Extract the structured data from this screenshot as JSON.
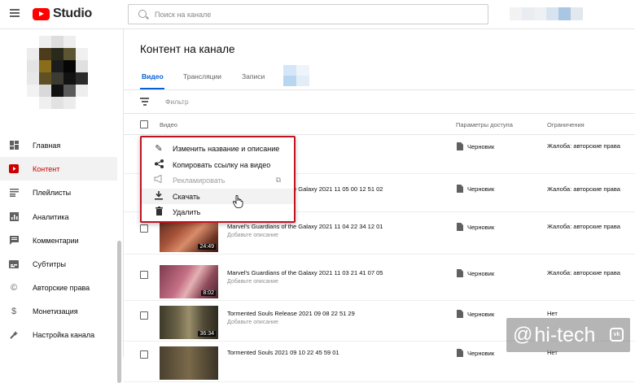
{
  "app": {
    "logo_text": "Studio",
    "brand_color": "#ff0000"
  },
  "search": {
    "placeholder": "Поиск на канале"
  },
  "sidebar": {
    "items": [
      {
        "label": "Главная",
        "icon": "dashboard-icon"
      },
      {
        "label": "Контент",
        "icon": "content-icon",
        "active": true
      },
      {
        "label": "Плейлисты",
        "icon": "playlist-icon"
      },
      {
        "label": "Аналитика",
        "icon": "analytics-icon"
      },
      {
        "label": "Комментарии",
        "icon": "comments-icon"
      },
      {
        "label": "Субтитры",
        "icon": "subtitles-icon"
      },
      {
        "label": "Авторские права",
        "icon": "copyright-icon"
      },
      {
        "label": "Монетизация",
        "icon": "dollar-icon"
      },
      {
        "label": "Настройка канала",
        "icon": "customization-icon"
      }
    ]
  },
  "page": {
    "title": "Контент на канале"
  },
  "tabs": [
    {
      "label": "Видео",
      "active": true
    },
    {
      "label": "Трансляции"
    },
    {
      "label": "Записи"
    }
  ],
  "filter": {
    "label": "Фильтр"
  },
  "table": {
    "headers": {
      "video": "Видео",
      "visibility": "Параметры доступа",
      "restrictions": "Ограничения"
    },
    "rows": [
      {
        "title": "",
        "description": "",
        "duration": "",
        "visibility": "Черновик",
        "restrictions": "Жалоба: авторские права"
      },
      {
        "title": "Marvel's Guardians of the Galaxy 2021 11 05 00 12 51 02",
        "description": "",
        "duration": "",
        "visibility": "Черновик",
        "restrictions": "Жалоба: авторские права"
      },
      {
        "title": "Marvel's Guardians of the Galaxy 2021 11 04 22 34 12 01",
        "description": "Добавьте описание",
        "duration": "24:49",
        "visibility": "Черновик",
        "restrictions": "Жалоба: авторские права"
      },
      {
        "title": "Marvel's Guardians of the Galaxy 2021 11 03 21 41 07 05",
        "description": "Добавьте описание",
        "duration": "8:02",
        "visibility": "Черновик",
        "restrictions": "Жалоба: авторские права"
      },
      {
        "title": "Tormented Souls Release 2021 09 08 22 51 29",
        "description": "Добавьте описание",
        "duration": "36:34",
        "visibility": "Черновик",
        "restrictions": "Нет"
      },
      {
        "title": "Tormented Souls 2021 09 10 22 45 59 01",
        "description": "",
        "duration": "",
        "visibility": "Черновик",
        "restrictions": "Нет"
      }
    ]
  },
  "context_menu": {
    "items": [
      {
        "label": "Изменить название и описание",
        "icon": "pencil-icon"
      },
      {
        "label": "Копировать ссылку на видео",
        "icon": "share-icon"
      },
      {
        "label": "Рекламировать",
        "icon": "megaphone-icon",
        "disabled": true
      },
      {
        "label": "Скачать",
        "icon": "download-icon",
        "hovered": true
      },
      {
        "label": "Удалить",
        "icon": "trash-icon"
      }
    ],
    "highlight_color": "#c1121f"
  },
  "watermark": {
    "at": "@",
    "brand": "hi-tech",
    "badge": "vk"
  }
}
